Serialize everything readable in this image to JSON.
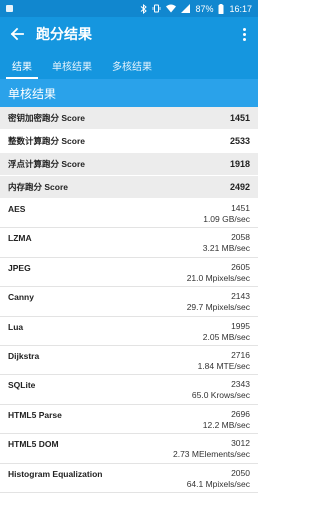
{
  "status_bar": {
    "battery": "87%",
    "time": "16:17"
  },
  "app_bar": {
    "title": "跑分结果"
  },
  "tabs": [
    {
      "label": "结果",
      "active": true
    },
    {
      "label": "单核结果",
      "active": false
    },
    {
      "label": "多核结果",
      "active": false
    }
  ],
  "section": {
    "title": "单核结果"
  },
  "scores": [
    {
      "label": "密钥加密跑分 Score",
      "value": "1451"
    },
    {
      "label": "整数计算跑分 Score",
      "value": "2533"
    },
    {
      "label": "浮点计算跑分 Score",
      "value": "1918"
    },
    {
      "label": "内存跑分 Score",
      "value": "2492"
    }
  ],
  "benchmarks": [
    {
      "name": "AES",
      "score": "1451",
      "rate": "1.09 GB/sec"
    },
    {
      "name": "LZMA",
      "score": "2058",
      "rate": "3.21 MB/sec"
    },
    {
      "name": "JPEG",
      "score": "2605",
      "rate": "21.0 Mpixels/sec"
    },
    {
      "name": "Canny",
      "score": "2143",
      "rate": "29.7 Mpixels/sec"
    },
    {
      "name": "Lua",
      "score": "1995",
      "rate": "2.05 MB/sec"
    },
    {
      "name": "Dijkstra",
      "score": "2716",
      "rate": "1.84 MTE/sec"
    },
    {
      "name": "SQLite",
      "score": "2343",
      "rate": "65.0 Krows/sec"
    },
    {
      "name": "HTML5 Parse",
      "score": "2696",
      "rate": "12.2 MB/sec"
    },
    {
      "name": "HTML5 DOM",
      "score": "3012",
      "rate": "2.73 MElements/sec"
    },
    {
      "name": "Histogram Equalization",
      "score": "2050",
      "rate": "64.1 Mpixels/sec"
    }
  ],
  "colors": {
    "status_bar": "#1187cf",
    "app_bar": "#1596df",
    "section_header": "#2aa2ea"
  }
}
